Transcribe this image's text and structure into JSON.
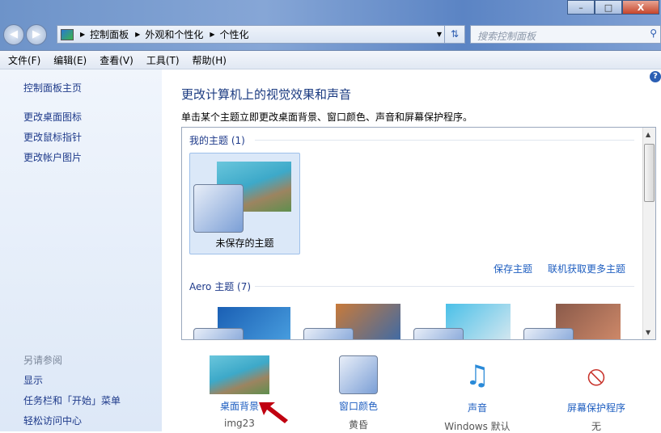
{
  "window": {
    "minimize": "–",
    "maximize": "□",
    "close": "X"
  },
  "address": {
    "crumbs": [
      "控制面板",
      "外观和个性化",
      "个性化"
    ],
    "search_placeholder": "搜索控制面板"
  },
  "menu": [
    "文件(F)",
    "编辑(E)",
    "查看(V)",
    "工具(T)",
    "帮助(H)"
  ],
  "sidebar": {
    "items": [
      "控制面板主页",
      "更改桌面图标",
      "更改鼠标指针",
      "更改帐户图片"
    ],
    "see_also": "另请参阅",
    "see_items": [
      "显示",
      "任务栏和「开始」菜单",
      "轻松访问中心"
    ]
  },
  "main": {
    "title": "更改计算机上的视觉效果和声音",
    "subtitle": "单击某个主题立即更改桌面背景、窗口颜色、声音和屏幕保护程序。",
    "my_themes": "我的主题 (1)",
    "unsaved": "未保存的主题",
    "save_theme": "保存主题",
    "more_themes": "联机获取更多主题",
    "aero_themes": "Aero 主题 (7)"
  },
  "bottom": [
    {
      "name": "桌面背景",
      "value": "img23"
    },
    {
      "name": "窗口颜色",
      "value": "黄昏"
    },
    {
      "name": "声音",
      "value": "Windows 默认"
    },
    {
      "name": "屏幕保护程序",
      "value": "无"
    }
  ],
  "help": "?"
}
